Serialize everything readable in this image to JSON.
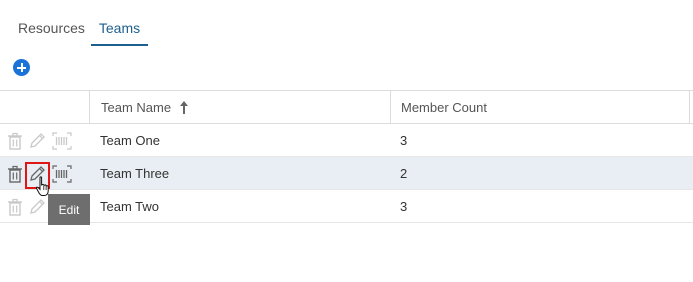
{
  "tabs": [
    {
      "label": "Resources",
      "active": false
    },
    {
      "label": "Teams",
      "active": true
    }
  ],
  "toolbar": {
    "add_icon": "plus-circle-icon"
  },
  "table": {
    "columns": [
      "Team Name",
      "Member Count"
    ],
    "sort": {
      "column": "Team Name",
      "direction": "ascending",
      "icon": "arrow-up-icon"
    },
    "rows": [
      {
        "name": "Team One",
        "count": "3"
      },
      {
        "name": "Team Three",
        "count": "2"
      },
      {
        "name": "Team Two",
        "count": "3"
      }
    ],
    "row_actions": [
      "trash-icon",
      "pencil-icon",
      "barcode-icon"
    ]
  },
  "tooltip": {
    "text": "Edit"
  },
  "colors": {
    "accent": "#1f5f8f",
    "add_button": "#1a73d9",
    "highlight_box": "#e01515",
    "selected_row": "#e8eef3",
    "tooltip_bg": "#6e6e6e"
  }
}
